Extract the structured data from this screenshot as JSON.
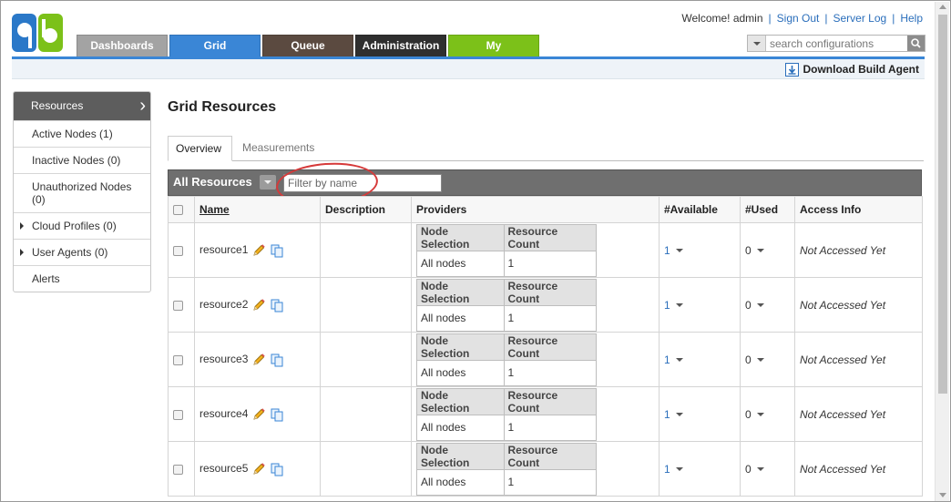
{
  "header": {
    "welcome": "Welcome! admin",
    "links": [
      "Sign Out",
      "Server Log",
      "Help"
    ],
    "search_placeholder": "search configurations",
    "download_label": "Download Build Agent"
  },
  "nav_tabs": [
    "Dashboards",
    "Grid",
    "Queue",
    "Administration",
    "My"
  ],
  "colors": {
    "accent": "#3a86d6",
    "my_tab": "#7cc119",
    "admin_tab": "#2f2f2f",
    "queue_tab": "#5b4a40",
    "dashboards_tab": "#a3a3a3"
  },
  "sidebar": {
    "header": "Resources",
    "items": [
      {
        "label": "Active Nodes (1)"
      },
      {
        "label": "Inactive Nodes (0)"
      },
      {
        "label": "Unauthorized Nodes (0)"
      },
      {
        "label": "Cloud Profiles (0)"
      },
      {
        "label": "User Agents (0)"
      },
      {
        "label": "Alerts"
      }
    ]
  },
  "main": {
    "title": "Grid Resources",
    "tabs": [
      "Overview",
      "Measurements"
    ],
    "grid_title": "All Resources",
    "filter_placeholder": "Filter by name",
    "columns": [
      "Name",
      "Description",
      "Providers",
      "#Available",
      "#Used",
      "Access Info"
    ],
    "provider_columns": [
      "Node Selection",
      "Resource Count"
    ],
    "rows": [
      {
        "name": "resource1",
        "description": "",
        "node_selection": "All nodes",
        "resource_count": "1",
        "available": "1",
        "used": "0",
        "access": "Not Accessed Yet"
      },
      {
        "name": "resource2",
        "description": "",
        "node_selection": "All nodes",
        "resource_count": "1",
        "available": "1",
        "used": "0",
        "access": "Not Accessed Yet"
      },
      {
        "name": "resource3",
        "description": "",
        "node_selection": "All nodes",
        "resource_count": "1",
        "available": "1",
        "used": "0",
        "access": "Not Accessed Yet"
      },
      {
        "name": "resource4",
        "description": "",
        "node_selection": "All nodes",
        "resource_count": "1",
        "available": "1",
        "used": "0",
        "access": "Not Accessed Yet"
      },
      {
        "name": "resource5",
        "description": "",
        "node_selection": "All nodes",
        "resource_count": "1",
        "available": "1",
        "used": "0",
        "access": "Not Accessed Yet"
      }
    ]
  }
}
